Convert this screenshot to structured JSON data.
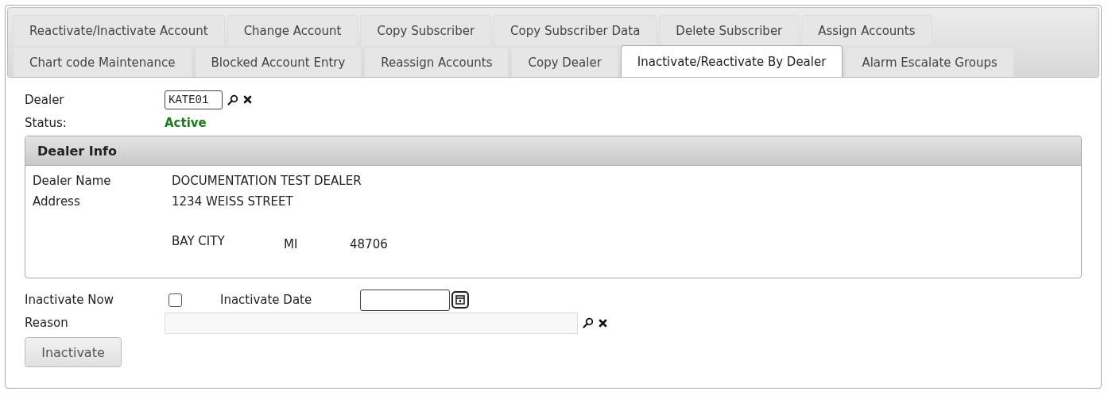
{
  "tab_rows": [
    {
      "tabs": [
        {
          "label": "Reactivate/Inactivate Account",
          "selected": false
        },
        {
          "label": "Change Account",
          "selected": false
        },
        {
          "label": "Copy Subscriber",
          "selected": false
        },
        {
          "label": "Copy Subscriber Data",
          "selected": false
        },
        {
          "label": "Delete Subscriber",
          "selected": false
        },
        {
          "label": "Assign Accounts",
          "selected": false
        }
      ]
    },
    {
      "tabs": [
        {
          "label": "Chart code Maintenance",
          "selected": false
        },
        {
          "label": "Blocked Account Entry",
          "selected": false
        },
        {
          "label": "Reassign Accounts",
          "selected": false
        },
        {
          "label": "Copy Dealer",
          "selected": false
        },
        {
          "label": "Inactivate/Reactivate By Dealer",
          "selected": true
        },
        {
          "label": "Alarm Escalate Groups",
          "selected": false
        }
      ]
    }
  ],
  "dealer": {
    "label": "Dealer",
    "value": "KATE01"
  },
  "status": {
    "label": "Status:",
    "value": "Active"
  },
  "dealer_info": {
    "title": "Dealer Info",
    "name_label": "Dealer Name",
    "name": "DOCUMENTATION TEST DEALER",
    "address_label": "Address",
    "street": "1234 WEISS STREET",
    "city": "BAY CITY",
    "state": "MI",
    "zip": "48706"
  },
  "inactivate_now": {
    "label": "Inactivate Now",
    "checked": false
  },
  "inactivate_date": {
    "label": "Inactivate Date"
  },
  "reason": {
    "label": "Reason"
  },
  "button": {
    "label": "Inactivate"
  }
}
